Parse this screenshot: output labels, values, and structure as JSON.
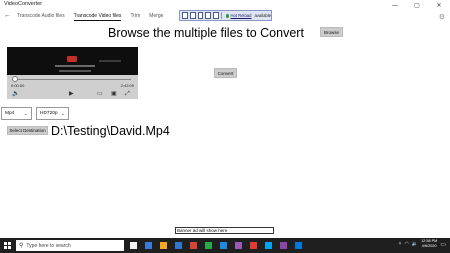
{
  "window": {
    "title": "VideoConverter",
    "controls": [
      "—",
      "▢",
      "✕"
    ]
  },
  "devbar": {
    "hot_reload": "Hot Reload",
    "hot_reload_status": "available"
  },
  "nav": {
    "back": "←",
    "tabs": [
      {
        "label": "Transcode Audio files",
        "active": false
      },
      {
        "label": "Transcode Video files",
        "active": true
      },
      {
        "label": "Trim",
        "active": false
      },
      {
        "label": "Merge",
        "active": false
      }
    ],
    "settings_icon": "gear-icon"
  },
  "main": {
    "heading": "Browse the multiple files to Convert",
    "browse_label": "Browse",
    "convert_label": "Convert",
    "format_select": "Mp4",
    "resolution_select": "HD720p",
    "destination_label": "Select Destination",
    "destination_path": "D:\\Testing\\David.Mp4"
  },
  "player": {
    "current_time": "0:00:00",
    "duration": "2:42:09",
    "progress": 0.0
  },
  "banner": {
    "text": "Banner ad will show here"
  },
  "taskbar": {
    "search_placeholder": "Type here to search",
    "clock_time": "12:58 PM",
    "clock_date": "4/6/2020",
    "app_colors": [
      "#f2f2f2",
      "#3a7bd5",
      "#f5a623",
      "#2f77c9",
      "#d74334",
      "#2ba84a",
      "#1e88e5",
      "#9b59b6",
      "#e53935",
      "#00a4ef",
      "#8e44ad",
      "#0078d7"
    ]
  },
  "colors": {
    "button_bg": "#cccccc",
    "taskbar_bg": "#1f1f1f",
    "devbar_bg": "#dfe5f2"
  }
}
